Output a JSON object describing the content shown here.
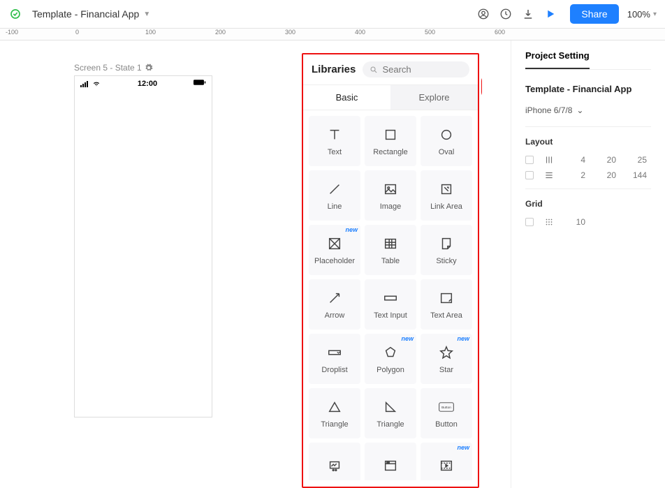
{
  "topbar": {
    "project_title": "Template - Financial App",
    "share_label": "Share",
    "zoom": "100%"
  },
  "ruler": {
    "ticks": [
      "-100",
      "0",
      "100",
      "200",
      "300",
      "400",
      "500",
      "600"
    ]
  },
  "canvas": {
    "screen_label": "Screen 5 - State 1",
    "statusbar_time": "12:00"
  },
  "libraries": {
    "title": "Libraries",
    "search_placeholder": "Search",
    "tabs": {
      "basic": "Basic",
      "explore": "Explore"
    },
    "new_badge": "new",
    "items": [
      {
        "label": "Text"
      },
      {
        "label": "Rectangle"
      },
      {
        "label": "Oval"
      },
      {
        "label": "Line"
      },
      {
        "label": "Image"
      },
      {
        "label": "Link Area"
      },
      {
        "label": "Placeholder",
        "new": true
      },
      {
        "label": "Table"
      },
      {
        "label": "Sticky"
      },
      {
        "label": "Arrow"
      },
      {
        "label": "Text Input"
      },
      {
        "label": "Text Area"
      },
      {
        "label": "Droplist"
      },
      {
        "label": "Polygon",
        "new": true
      },
      {
        "label": "Star",
        "new": true
      },
      {
        "label": "Triangle"
      },
      {
        "label": "Triangle"
      },
      {
        "label": "Button"
      },
      {
        "label": ""
      },
      {
        "label": ""
      },
      {
        "label": "",
        "new": true
      }
    ]
  },
  "rightpanel": {
    "title": "Project Setting",
    "subtitle": "Template - Financial App",
    "device": "iPhone 6/7/8",
    "layout_label": "Layout",
    "layout_rows": [
      {
        "v1": "4",
        "v2": "20",
        "v3": "25"
      },
      {
        "v1": "2",
        "v2": "20",
        "v3": "144"
      }
    ],
    "grid_label": "Grid",
    "grid_value": "10"
  }
}
